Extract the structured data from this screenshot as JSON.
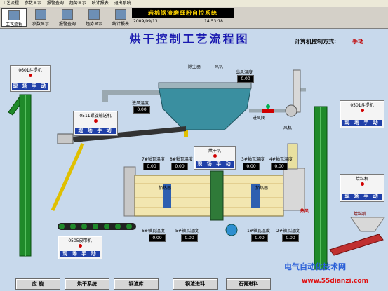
{
  "menu": [
    "工艺流程",
    "参数显示",
    "报警查询",
    "趋势显示",
    "统计报表",
    "退出系统"
  ],
  "toolbar": [
    {
      "label": "工艺流程",
      "active": true
    },
    {
      "label": "参数显示",
      "active": false
    },
    {
      "label": "报警查询",
      "active": false
    },
    {
      "label": "趋势显示",
      "active": false
    },
    {
      "label": "统计报表",
      "active": false
    }
  ],
  "header": {
    "system_name": "岩棉钢渣磨细粉自控系统",
    "date": "2009/09/13",
    "time": "14:53:18",
    "title": "烘干控制工艺流程图",
    "mode_label": "计算机控制方式:",
    "mode_value": "手动"
  },
  "equipment": {
    "bucket_0601": {
      "label": "0601斗提机",
      "state": "现 场 手 动"
    },
    "screw_0511": {
      "label": "0511螺旋输送机",
      "state": "现 场 手 动"
    },
    "dryer": {
      "label": "烘干机",
      "state": "现 场 手 动"
    },
    "belt_0505": {
      "label": "0505皮带机",
      "state": "现 场 手 动"
    },
    "bucket_0501": {
      "label": "0501斗提机",
      "state": "现 场 手 动"
    },
    "feeder": {
      "label": "给料机",
      "state": "现 场 手 动"
    },
    "dust_collector": "除尘器",
    "fan": "风机",
    "damper": "进风阀",
    "induced_fan": "风机",
    "hot_air": "热风",
    "heater_left": "加热器",
    "heater_right": "加热器",
    "bin": "给料机"
  },
  "temps": [
    {
      "label": "出风温度",
      "value": "0.00"
    },
    {
      "label": "进风温度",
      "value": "0.00"
    },
    {
      "label": "7#轴瓦温度",
      "value": "0.00"
    },
    {
      "label": "8#轴瓦温度",
      "value": "0.00"
    },
    {
      "label": "3#轴瓦温度",
      "value": "0.00"
    },
    {
      "label": "4#轴瓦温度",
      "value": "0.00"
    },
    {
      "label": "6#轴瓦温度",
      "value": "0.00"
    },
    {
      "label": "5#轴瓦温度",
      "value": "0.00"
    },
    {
      "label": "1#轴瓦温度",
      "value": "0.00"
    },
    {
      "label": "2#轴瓦温度",
      "value": "0.00"
    }
  ],
  "buttons": [
    "应 旋",
    "烘干系统",
    "钢渣库",
    "钢渣进料",
    "石膏进料"
  ],
  "watermark": {
    "line1": "电气自动化技术网",
    "line2": "www.55dianzi.com"
  },
  "colors": {
    "background": "#c8d9ec",
    "elevator": "#1f8a2a",
    "state_bar": "#1f3fa8",
    "led_red": "#d00000",
    "dryer": "#f2e6b0",
    "title": "#1a1ab0"
  }
}
